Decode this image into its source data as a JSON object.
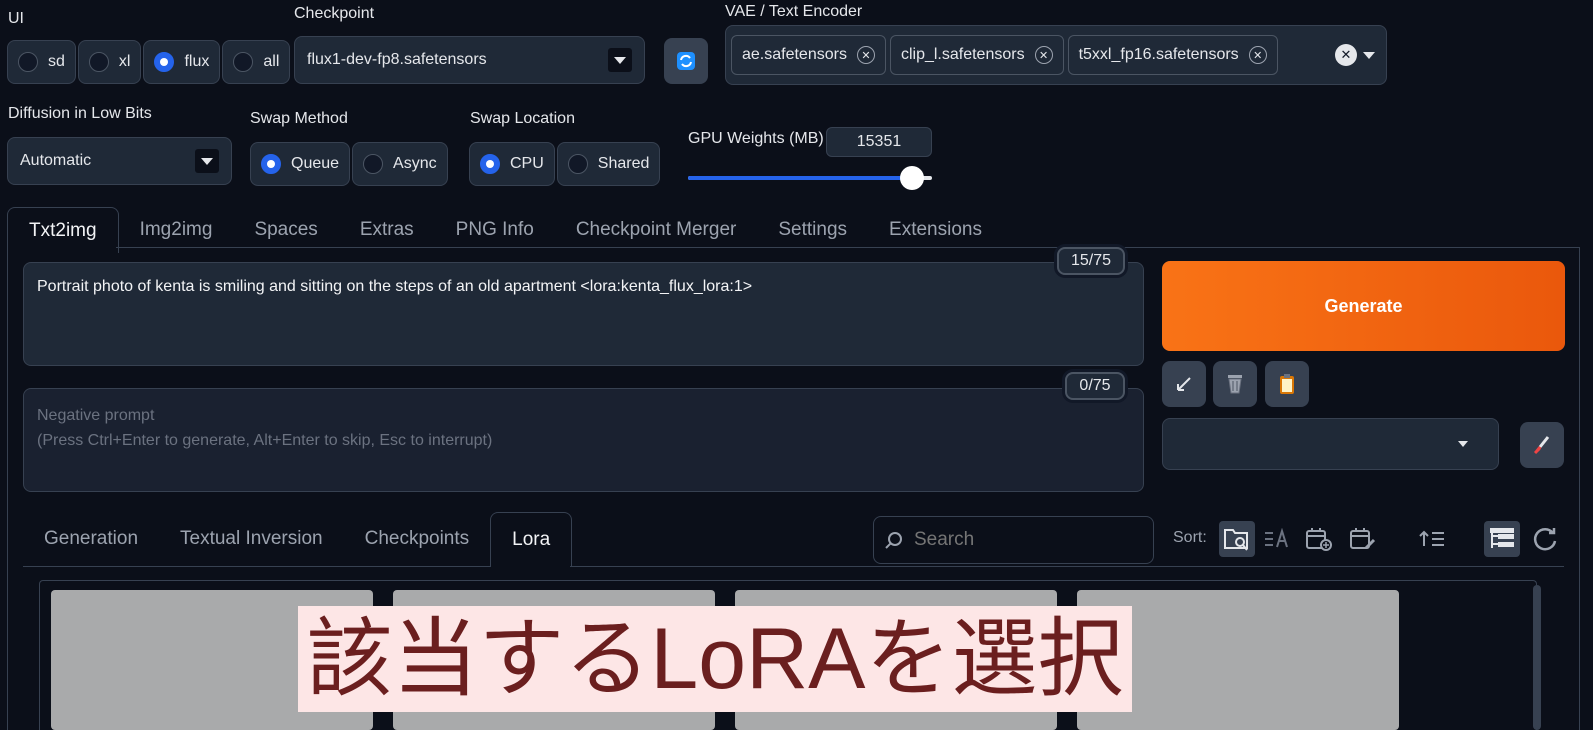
{
  "ui": {
    "label": "UI",
    "options": [
      {
        "label": "sd",
        "checked": false
      },
      {
        "label": "xl",
        "checked": false
      },
      {
        "label": "flux",
        "checked": true
      },
      {
        "label": "all",
        "checked": false
      }
    ]
  },
  "checkpoint": {
    "label": "Checkpoint",
    "value": "flux1-dev-fp8.safetensors"
  },
  "vae": {
    "label": "VAE / Text Encoder",
    "chips": [
      "ae.safetensors",
      "clip_l.safetensors",
      "t5xxl_fp16.safetensors"
    ]
  },
  "diffusion": {
    "label": "Diffusion in Low Bits",
    "value": "Automatic"
  },
  "swap_method": {
    "label": "Swap Method",
    "options": [
      {
        "label": "Queue",
        "checked": true
      },
      {
        "label": "Async",
        "checked": false
      }
    ]
  },
  "swap_location": {
    "label": "Swap Location",
    "options": [
      {
        "label": "CPU",
        "checked": true
      },
      {
        "label": "Shared",
        "checked": false
      }
    ]
  },
  "gpu_weights": {
    "label": "GPU Weights (MB)",
    "value": "15351",
    "fraction": 0.92
  },
  "tabs": [
    "Txt2img",
    "Img2img",
    "Spaces",
    "Extras",
    "PNG Info",
    "Checkpoint Merger",
    "Settings",
    "Extensions"
  ],
  "prompt": {
    "text": "Portrait photo of kenta is smiling and sitting on the steps of an old apartment <lora:kenta_flux_lora:1>",
    "counter": "15/75"
  },
  "negative": {
    "placeholder_line1": "Negative prompt",
    "placeholder_line2": "(Press Ctrl+Enter to generate, Alt+Enter to skip, Esc to interrupt)",
    "counter": "0/75"
  },
  "generate_label": "Generate",
  "subtabs": [
    "Generation",
    "Textual Inversion",
    "Checkpoints",
    "Lora"
  ],
  "search": {
    "placeholder": "Search"
  },
  "sort_label": "Sort:",
  "overlay_text": "該当するLoRAを選択",
  "colors": {
    "accent": "#f97316",
    "radio": "#2563eb",
    "bg": "#0b0f19"
  }
}
